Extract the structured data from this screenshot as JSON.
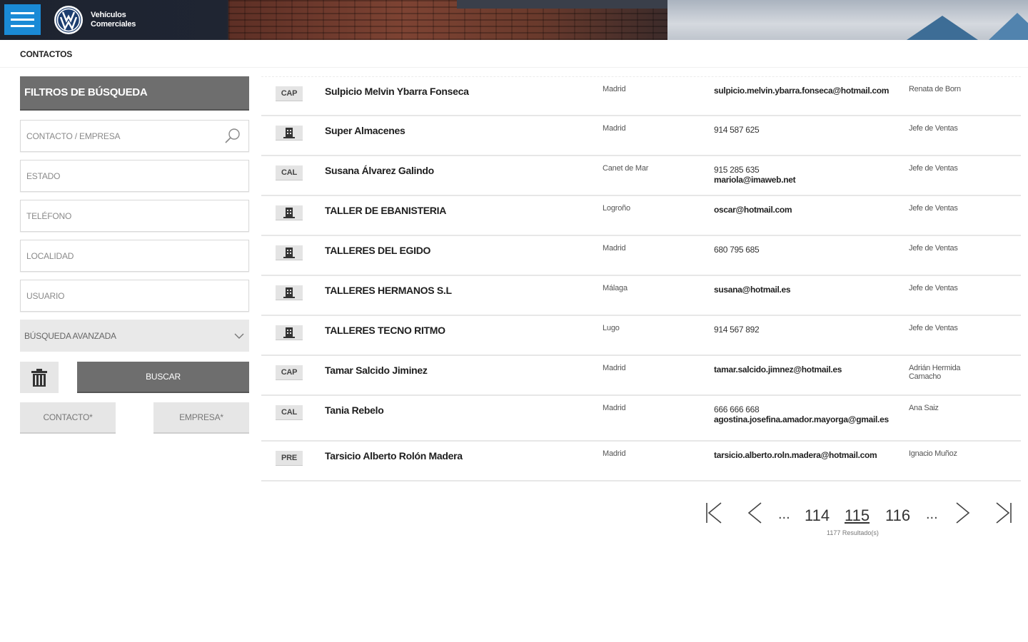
{
  "header": {
    "brand_line1": "Vehículos",
    "brand_line2": "Comerciales"
  },
  "page": {
    "title": "CONTACTOS"
  },
  "filters": {
    "title": "FILTROS DE BÚSQUEDA",
    "contact_placeholder": "CONTACTO / EMPRESA",
    "state_placeholder": "ESTADO",
    "phone_placeholder": "TELÉFONO",
    "locality_placeholder": "LOCALIDAD",
    "user_placeholder": "USUARIO",
    "advanced_label": "BÚSQUEDA AVANZADA",
    "search_label": "BUSCAR",
    "contact_type_label": "CONTACTO*",
    "company_type_label": "EMPRESA*"
  },
  "rows": [
    {
      "badge": "CAP",
      "icon": "",
      "name": "Sulpicio Melvin Ybarra Fonseca",
      "city": "Madrid",
      "phone": "",
      "email": "sulpicio.melvin.ybarra.fonseca@hotmail.com",
      "user": "Renata de Born"
    },
    {
      "badge": "",
      "icon": "building-icon",
      "name": "Super Almacenes",
      "city": "Madrid",
      "phone": "914 587 625",
      "email": "",
      "user": "Jefe de Ventas"
    },
    {
      "badge": "CAL",
      "icon": "",
      "name": "Susana Álvarez Galindo",
      "city": "Canet de Mar",
      "phone": "915 285 635",
      "email": "mariola@imaweb.net",
      "user": "Jefe de Ventas"
    },
    {
      "badge": "",
      "icon": "building-icon",
      "name": "TALLER DE EBANISTERIA",
      "city": "Logroño",
      "phone": "",
      "email": "oscar@hotmail.com",
      "user": "Jefe de Ventas"
    },
    {
      "badge": "",
      "icon": "building-icon",
      "name": "TALLERES DEL EGIDO",
      "city": "Madrid",
      "phone": "680 795 685",
      "email": "",
      "user": "Jefe de Ventas"
    },
    {
      "badge": "",
      "icon": "building-icon",
      "name": "TALLERES HERMANOS S.L",
      "city": "Málaga",
      "phone": "",
      "email": "susana@hotmail.es",
      "user": "Jefe de Ventas"
    },
    {
      "badge": "",
      "icon": "building-icon",
      "name": "TALLERES TECNO RITMO",
      "city": "Lugo",
      "phone": "914 567 892",
      "email": "",
      "user": "Jefe de Ventas"
    },
    {
      "badge": "CAP",
      "icon": "",
      "name": "Tamar Salcido Jiminez",
      "city": "Madrid",
      "phone": "",
      "email": "tamar.salcido.jimnez@hotmail.es",
      "user": "Adrián Hermida Camacho"
    },
    {
      "badge": "CAL",
      "icon": "",
      "name": "Tania Rebelo",
      "city": "Madrid",
      "phone": "666 666 668",
      "email": "agostina.josefina.amador.mayorga@gmail.es",
      "user": "Ana Saiz"
    },
    {
      "badge": "PRE",
      "icon": "",
      "name": "Tarsicio Alberto Rolón Madera",
      "city": "Madrid",
      "phone": "",
      "email": "tarsicio.alberto.roln.madera@hotmail.com",
      "user": "Ignacio Muñoz"
    }
  ],
  "pagination": {
    "prev_dots": "...",
    "page_prev": "114",
    "page_current": "115",
    "page_next": "116",
    "next_dots": "...",
    "result_count": "1177 Resultado(s)"
  }
}
